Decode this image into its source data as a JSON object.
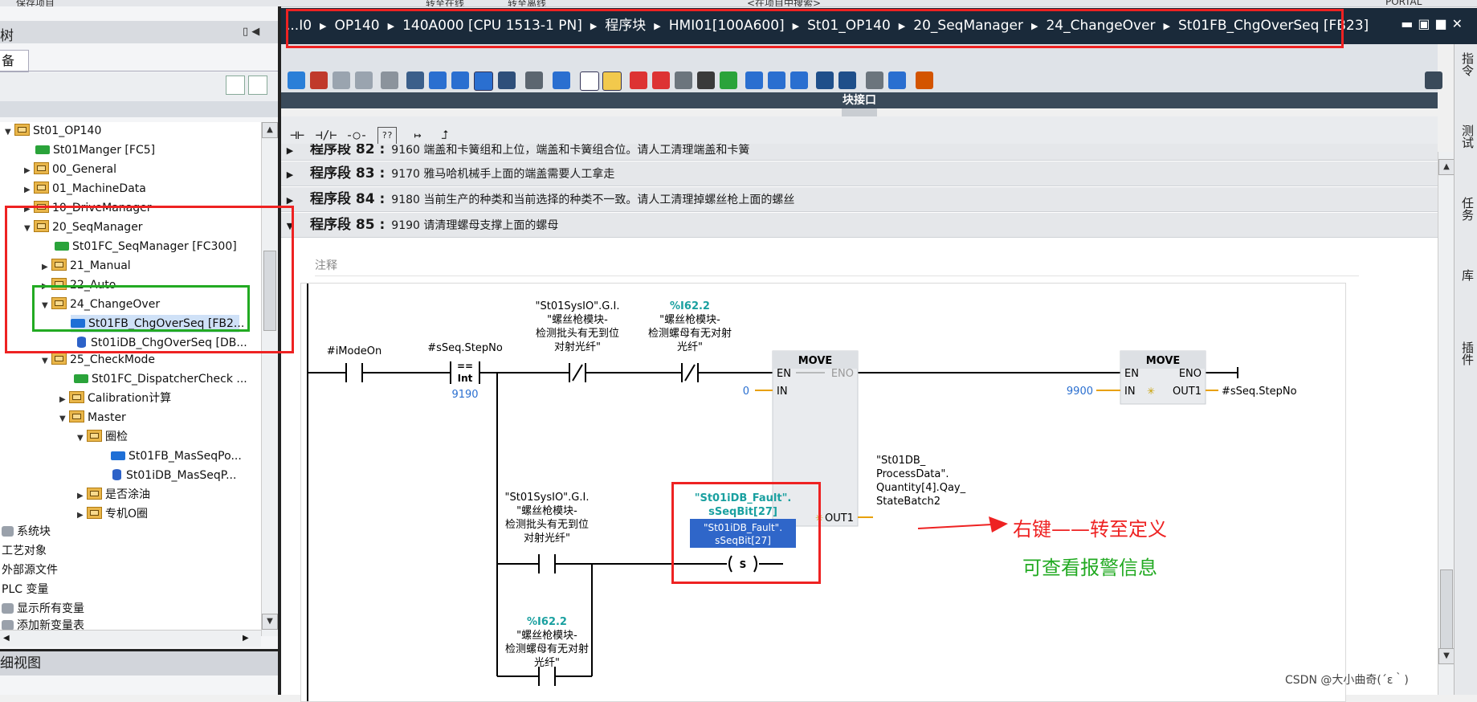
{
  "top_toolbar": {
    "items": [
      "保存项目",
      "转至在线",
      "转至离线",
      "<在项目中搜索>",
      "PORTAL"
    ]
  },
  "project_tree": {
    "header_title": "树",
    "tab_label": "备",
    "rows": [
      {
        "label": "St01_OP140",
        "kind": "folder",
        "expanded": true
      },
      {
        "label": "St01Manger [FC5]",
        "kind": "fc"
      },
      {
        "label": "00_General",
        "kind": "folder",
        "expanded": false
      },
      {
        "label": "01_MachineData",
        "kind": "folder",
        "expanded": false
      },
      {
        "label": "10_DriveManager",
        "kind": "folder",
        "expanded": false
      },
      {
        "label": "20_SeqManager",
        "kind": "folder",
        "expanded": true
      },
      {
        "label": "St01FC_SeqManager [FC300]",
        "kind": "fc"
      },
      {
        "label": "21_Manual",
        "kind": "folder",
        "expanded": false
      },
      {
        "label": "22_Auto",
        "kind": "folder",
        "expanded": false
      },
      {
        "label": "24_ChangeOver",
        "kind": "folder",
        "expanded": true
      },
      {
        "label": "St01FB_ChgOverSeq [FB2...",
        "kind": "fb",
        "selected": true
      },
      {
        "label": "St01iDB_ChgOverSeq [DB...",
        "kind": "db"
      },
      {
        "label": "25_CheckMode",
        "kind": "folder",
        "expanded": true
      },
      {
        "label": "St01FC_DispatcherCheck ...",
        "kind": "fc"
      },
      {
        "label": "Calibration计算",
        "kind": "folder",
        "expanded": false
      },
      {
        "label": "Master",
        "kind": "folder",
        "expanded": true
      },
      {
        "label": "圈检",
        "kind": "folder",
        "expanded": true
      },
      {
        "label": "St01FB_MasSeqPo...",
        "kind": "fb"
      },
      {
        "label": "St01iDB_MasSeqP...",
        "kind": "db"
      },
      {
        "label": "是否涂油",
        "kind": "folder",
        "expanded": false
      },
      {
        "label": "专机O圈",
        "kind": "folder",
        "expanded": false
      },
      {
        "label": "系统块",
        "kind": "sys"
      },
      {
        "label": "工艺对象",
        "kind": "plain"
      },
      {
        "label": "外部源文件",
        "kind": "plain"
      },
      {
        "label": "PLC 变量",
        "kind": "plain"
      },
      {
        "label": "显示所有变量",
        "kind": "sys"
      },
      {
        "label": "添加新变量表",
        "kind": "sys"
      }
    ],
    "detail_view_label": "细视图"
  },
  "breadcrumb": {
    "items": [
      "...I0",
      "OP140",
      "140A000 [CPU 1513-1 PN]",
      "程序块",
      "HMI01[100A600]",
      "St01_OP140",
      "20_SeqManager",
      "24_ChangeOver",
      "St01FB_ChgOverSeq [FB23]"
    ]
  },
  "editor": {
    "block_interface_label": "块接口",
    "networks": [
      {
        "label": "程序段 82 :",
        "comment": "9160 端盖和卡簧组和上位，端盖和卡簧组合位。请人工清理端盖和卡簧"
      },
      {
        "label": "程序段 83 :",
        "comment": "9170  雅马哈机械手上面的端盖需要人工拿走"
      },
      {
        "label": "程序段 84 :",
        "comment": "9180 当前生产的种类和当前选择的种类不一致。请人工清理掉螺丝枪上面的螺丝"
      },
      {
        "label": "程序段 85 :",
        "comment": "9190 请清理螺母支撑上面的螺母"
      }
    ],
    "network_note": "注释",
    "ladder": {
      "contact_mode": "#iModeOn",
      "cmp_operand": "#sSeq.StepNo",
      "cmp_op": "==",
      "cmp_type": "Int",
      "cmp_value": "9190",
      "nc1_line1": "\"St01SysIO\".G.I.",
      "nc1_line2": "\"螺丝枪模块-",
      "nc1_line3": "检测批头有无到位",
      "nc1_line4": "对射光纤\"",
      "nc2_addr": "%I62.2",
      "nc2_line1": "\"螺丝枪模块-",
      "nc2_line2": "检测螺母有无对射",
      "nc2_line3": "光纤\"",
      "move1_title": "MOVE",
      "move1_en": "EN",
      "move1_eno": "ENO",
      "move1_in_label": "IN",
      "move1_in_val": "0",
      "move1_out_label": "OUT1",
      "move1_out_line1": "\"St01DB_",
      "move1_out_line2": "ProcessData\".",
      "move1_out_line3": "Quantity[4].Qay_",
      "move1_out_line4": "StateBatch2",
      "move2_title": "MOVE",
      "move2_en": "EN",
      "move2_eno": "ENO",
      "move2_in_label": "IN",
      "move2_in_val": "9900",
      "move2_out_label": "OUT1",
      "move2_out_val": "#sSeq.StepNo",
      "no1_line1": "\"St01SysIO\".G.I.",
      "no1_line2": "\"螺丝枪模块-",
      "no1_line3": "检测批头有无到位",
      "no1_line4": "对射光纤\"",
      "coil_top1": "\"St01iDB_Fault\".",
      "coil_top2": "sSeqBit[27]",
      "coil_sel1": "\"St01iDB_Fault\".",
      "coil_sel2": "sSeqBit[27]",
      "coil_symbol": "S",
      "no2_addr": "%I62.2",
      "no2_line1": "\"螺丝枪模块-",
      "no2_line2": "检测螺母有无对射",
      "no2_line3": "光纤\""
    }
  },
  "annotations": {
    "arrow_text": "右键——转至定义",
    "hint_text": "可查看报警信息"
  },
  "right_tabs": [
    "指令",
    "测试",
    "任务",
    "库",
    "插件"
  ],
  "watermark": "CSDN @大小曲奇(´ε｀)",
  "colors": {
    "highlight_red": "#ee2222",
    "highlight_green": "#22aa22",
    "tag_teal": "#1aa0a0",
    "value_blue": "#2a6fd0"
  }
}
